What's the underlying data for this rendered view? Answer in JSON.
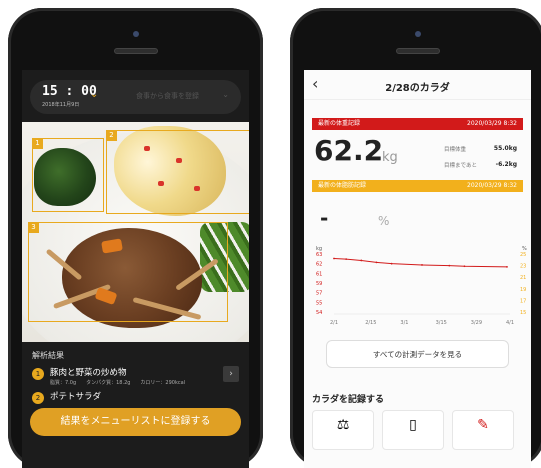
{
  "left_phone": {
    "time": "15 : 00",
    "date": "2018年11月9日",
    "meal_placeholder": "食事から食事を登録",
    "results_title": "解析結果",
    "results": [
      {
        "num": "1",
        "name": "豚肉と野菜の炒め物",
        "meta": "脂質：7.0g　　タンパク質：18.2g　　カロリー：290kcal"
      },
      {
        "num": "2",
        "name": "ポテトサラダ"
      }
    ],
    "bbox_labels": [
      "1",
      "2",
      "3"
    ],
    "register_button": "結果をメニューリストに登録する"
  },
  "right_phone": {
    "title": "2/28のカラダ",
    "weight_banner": {
      "label": "最新の体重記録",
      "date": "2020/03/29 8:32"
    },
    "weight_value": "62.2",
    "weight_unit": "kg",
    "stats": [
      {
        "label": "目標体重",
        "value": "55.0kg"
      },
      {
        "label": "目標まであと",
        "value": "-6.2kg"
      }
    ],
    "fat_banner": {
      "label": "最新の体脂肪記録",
      "date": "2020/03/29 8:32"
    },
    "fat_value": "-",
    "fat_unit": "%",
    "all_data_button": "すべての計測データを見る",
    "record_title": "カラダを記録する"
  },
  "colors": {
    "accent": "#e8a91e",
    "weight_red": "#d21a1a",
    "fat_yellow": "#f2b01c"
  },
  "chart_data": {
    "type": "line",
    "left_axis_unit": "kg",
    "right_axis_unit": "%",
    "y_left_ticks": [
      "63",
      "62",
      "61",
      "59",
      "57",
      "55",
      "54"
    ],
    "y_right_ticks": [
      "25",
      "23",
      "21",
      "19",
      "17",
      "15"
    ],
    "x_ticks": [
      "2/1",
      "2/15",
      "3/1",
      "3/15",
      "3/29",
      "4/1"
    ],
    "series": [
      {
        "x": [
          "2/1",
          "2/5",
          "2/10",
          "2/15",
          "2/20",
          "3/1",
          "3/10",
          "3/15",
          "3/29"
        ],
        "values": [
          62.3,
          62.2,
          62.0,
          61.7,
          61.5,
          61.3,
          61.2,
          61.1,
          61.0
        ]
      }
    ],
    "ylim": [
      54,
      63
    ],
    "grid": false
  }
}
